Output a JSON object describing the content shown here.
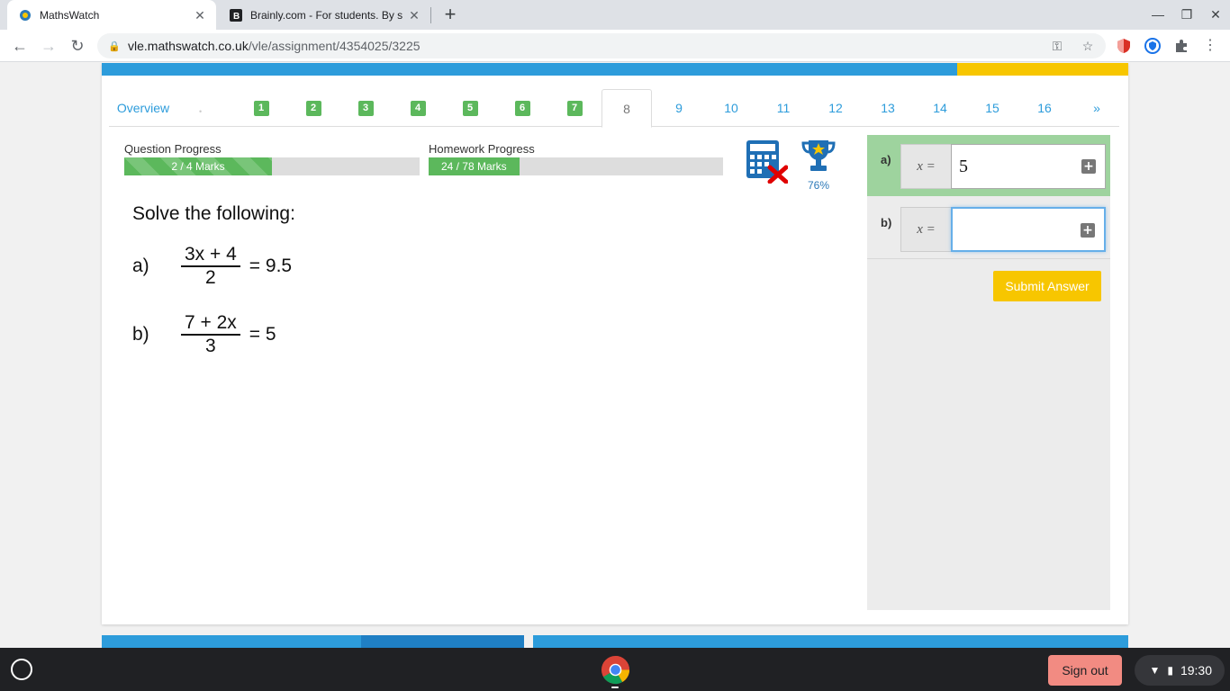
{
  "browser": {
    "tabs": [
      {
        "title": "MathsWatch",
        "active": true
      },
      {
        "title": "Brainly.com - For students. By s",
        "active": false
      }
    ],
    "url_host": "vle.mathswatch.co.uk",
    "url_path": "/vle/assignment/4354025/3225"
  },
  "nav": {
    "overview_label": "Overview",
    "current_question": "8",
    "completed": [
      "1",
      "2",
      "3",
      "4",
      "5",
      "6",
      "7"
    ],
    "upcoming": [
      "9",
      "10",
      "11",
      "12",
      "13",
      "14",
      "15",
      "16"
    ],
    "next_label": "»"
  },
  "progress": {
    "question": {
      "label": "Question Progress",
      "text": "2 / 4 Marks",
      "fraction": 0.5
    },
    "homework": {
      "label": "Homework Progress",
      "text": "24 / 78 Marks",
      "fraction": 0.3077
    }
  },
  "trophy_percent": "76%",
  "question": {
    "title": "Solve the following:",
    "parts": [
      {
        "letter": "a)",
        "numerator": "3x + 4",
        "denominator": "2",
        "rhs": "= 9.5"
      },
      {
        "letter": "b)",
        "numerator": "7 + 2x",
        "denominator": "3",
        "rhs": "= 5"
      }
    ]
  },
  "answers": [
    {
      "letter": "a)",
      "prefix": "x =",
      "value": "5",
      "status": "correct"
    },
    {
      "letter": "b)",
      "prefix": "x =",
      "value": "",
      "status": "pending"
    }
  ],
  "submit_label": "Submit Answer",
  "shelf": {
    "signout_label": "Sign out",
    "time": "19:30"
  },
  "colors": {
    "brand_blue": "#2d9cdb",
    "green": "#5cb85c",
    "yellow": "#f7c600",
    "correct_bg": "#9ed39e"
  }
}
